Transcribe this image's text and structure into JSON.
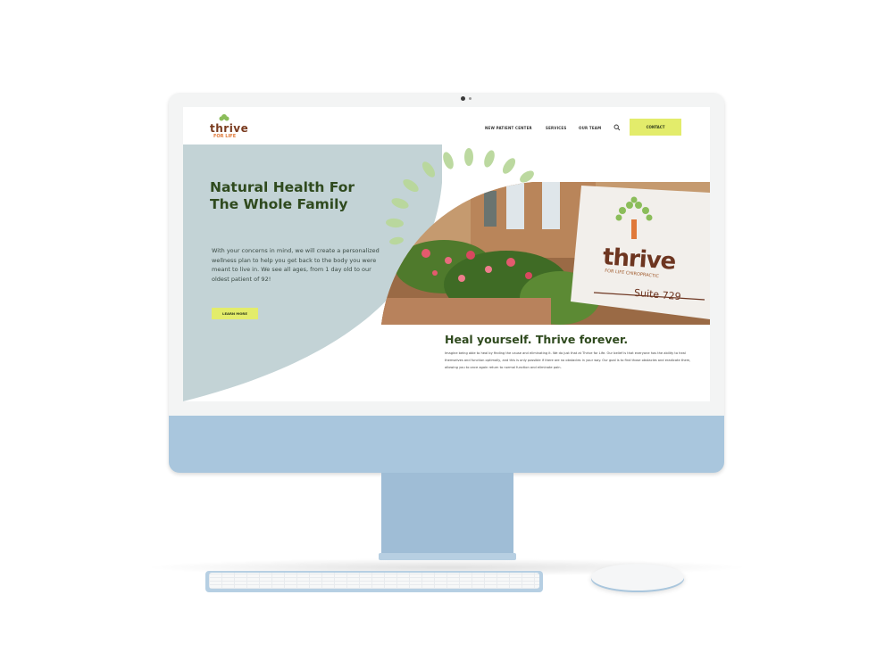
{
  "site": {
    "logo": {
      "word": "thrive",
      "tagline": "FOR LIFE"
    },
    "nav": {
      "items": [
        "NEW PATIENT CENTER",
        "SERVICES",
        "OUR TEAM"
      ],
      "contact": "CONTACT"
    },
    "hero": {
      "title": "Natural Health For The Whole Family",
      "body": "With your concerns in mind, we will create a personalized wellness plan to help you get back to the body you were meant to live in. We see all ages, from 1 day old to our oldest patient of 92!",
      "cta": "LEARN MORE"
    },
    "sign": {
      "word": "thrive",
      "sub": "FOR LIFE CHIROPRACTIC",
      "suite": "Suite 729"
    },
    "section": {
      "heading": "Heal yourself. Thrive forever.",
      "body": "Imagine being able to heal by finding the cause and eliminating it. We do just that at Thrive for Life. Our belief is that everyone has the ability to heal themselves and function optimally, and this is only possible if there are no obstacles in your way. Our goal is to find those obstacles and eradicate them, allowing you to once again return to normal function and eliminate pain."
    }
  },
  "colors": {
    "hero_bg": "#c3d3d6",
    "heading_green": "#2f4a1e",
    "button_yellow": "#e3ec6b",
    "monitor_blue": "#a9c6dd",
    "brand_brown": "#7a3b1f"
  },
  "icons": [
    "search-icon",
    "tree-logo-icon"
  ]
}
